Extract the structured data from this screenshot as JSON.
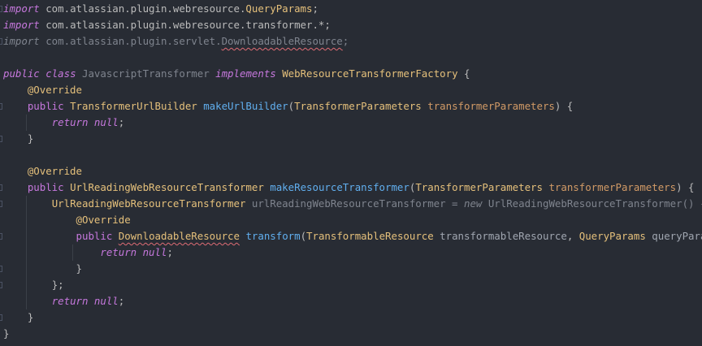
{
  "colors": {
    "background": "#282c34",
    "keyword": "#c678dd",
    "type": "#e5c07b",
    "function": "#61afef",
    "parameter": "#d19a66",
    "text": "#bbbbbb",
    "unused": "#7f848e",
    "error_underline": "#e06c75"
  },
  "code": {
    "l1": {
      "kw": "import",
      "path": " com.atlassian.plugin.webresource.",
      "cls": "QueryParams",
      "end": ";"
    },
    "l2": {
      "kw": "import",
      "path": " com.atlassian.plugin.webresource.transformer.*;"
    },
    "l3": {
      "kw": "import",
      "path": " com.atlassian.plugin.servlet.",
      "cls": "DownloadableResource",
      "end": ";"
    },
    "l5": {
      "kw1": "public",
      "kw2": "class",
      "name": "JavascriptTransformer",
      "kw3": "implements",
      "iface": "WebResourceTransformerFactory",
      "brace": " {"
    },
    "l6": {
      "ann": "@Override"
    },
    "l7": {
      "kw": "public",
      "ret": "TransformerUrlBuilder",
      "fn": "makeUrlBuilder",
      "open": "(",
      "ptype": "TransformerParameters",
      "pname": "transformerParameters",
      "close": ") {"
    },
    "l8": {
      "kw": "return",
      "val": "null",
      "end": ";"
    },
    "l9": {
      "brace": "}"
    },
    "l11": {
      "ann": "@Override"
    },
    "l12": {
      "kw": "public",
      "ret": "UrlReadingWebResourceTransformer",
      "fn": "makeResourceTransformer",
      "open": "(",
      "ptype": "TransformerParameters",
      "pname": "transformerParameters",
      "close": ") {"
    },
    "l13": {
      "type": "UrlReadingWebResourceTransformer",
      "var": "urlReadingWebResourceTransformer",
      "eq": " = ",
      "kw": "new",
      "ctor": "UrlReadingWebResourceTransformer",
      "end": "() {"
    },
    "l14": {
      "ann": "@Override"
    },
    "l15": {
      "kw": "public",
      "ret": "DownloadableResource",
      "fn": "transform",
      "open": "(",
      "ptype1": "TransformableResource",
      "pname1": "transformableResource",
      "sep": ", ",
      "ptype2": "QueryParams",
      "pname2": "queryParams",
      "close": ") {"
    },
    "l16": {
      "kw": "return",
      "val": "null",
      "end": ";"
    },
    "l17": {
      "brace": "}"
    },
    "l18": {
      "brace": "};"
    },
    "l19": {
      "kw": "return",
      "val": "null",
      "end": ";"
    },
    "l20": {
      "brace": "}"
    },
    "l21": {
      "brace": "}"
    }
  }
}
